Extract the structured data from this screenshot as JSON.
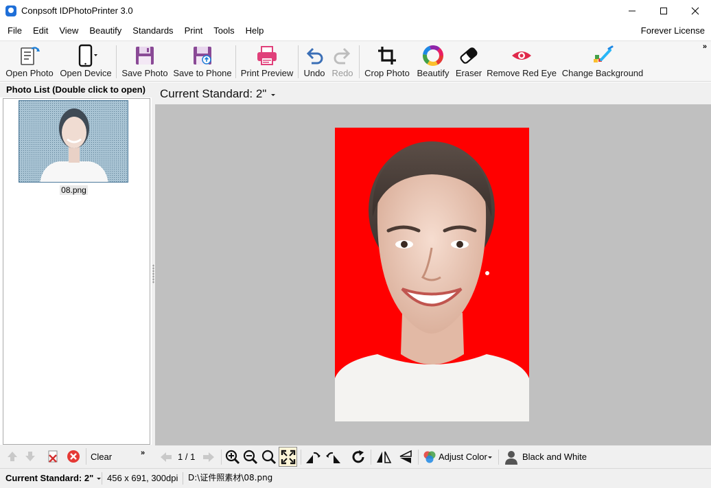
{
  "window": {
    "title": "Conpsoft IDPhotoPrinter 3.0",
    "license": "Forever License"
  },
  "menu": [
    "File",
    "Edit",
    "View",
    "Beautify",
    "Standards",
    "Print",
    "Tools",
    "Help"
  ],
  "toolbar": {
    "open_photo": "Open Photo",
    "open_device": "Open Device",
    "save_photo": "Save Photo",
    "save_to_phone": "Save to Phone",
    "print_preview": "Print Preview",
    "undo": "Undo",
    "redo": "Redo",
    "crop_photo": "Crop Photo",
    "beautify": "Beautify",
    "eraser": "Eraser",
    "remove_red_eye": "Remove Red Eye",
    "change_background": "Change Background",
    "more": "»"
  },
  "photo_list": {
    "header": "Photo List (Double click to open)",
    "items": [
      {
        "name": "08.png"
      }
    ],
    "clear_label": "Clear",
    "more": "»"
  },
  "standard_bar": {
    "label": "Current Standard: 2\""
  },
  "preview": {
    "background_color": "#ff0000"
  },
  "bottom_bar": {
    "page_indicator": "1 / 1",
    "adjust_color": "Adjust Color",
    "black_and_white": "Black and White"
  },
  "status": {
    "standard": "Current Standard: 2\"",
    "dimensions": "456 x 691, 300dpi",
    "path": "D:\\证件照素材\\08.png"
  }
}
